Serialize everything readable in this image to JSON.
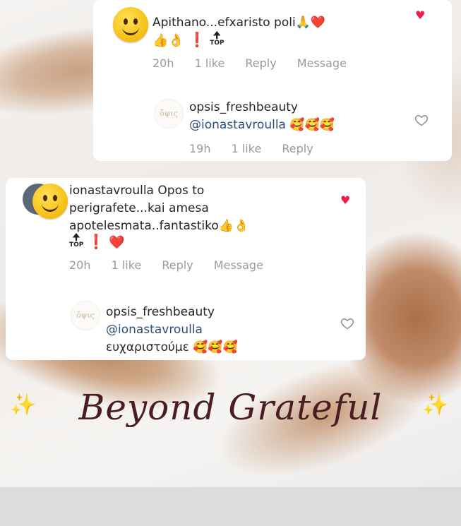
{
  "card1": {
    "comment": {
      "text": "Apithano...efxaristo poli",
      "emojis_line1": "🙏❤️",
      "emojis_line2": "👍👌",
      "top_label": "TOP",
      "meta": {
        "time": "20h",
        "likes": "1 like",
        "reply": "Reply",
        "message": "Message"
      }
    },
    "reply": {
      "username": "opsis_freshbeauty",
      "mention": "@ionastavroulla",
      "emojis": "🥰🥰🥰",
      "meta": {
        "time": "19h",
        "likes": "1 like",
        "reply": "Reply"
      }
    }
  },
  "card2": {
    "comment": {
      "username": "ionastavroulla",
      "text_line1": "Opos to",
      "text_line2": "perigrafete...kai amesa",
      "text_line3": "apotelesmata..fantastiko",
      "emojis_line3": "👍👌",
      "top_label": "TOP",
      "meta": {
        "time": "20h",
        "likes": "1 like",
        "reply": "Reply",
        "message": "Message"
      }
    },
    "reply": {
      "username": "opsis_freshbeauty",
      "mention": "@ionastavroulla",
      "text": "ευχαριστούμε",
      "emojis": "🥰🥰🥰"
    }
  },
  "brand_avatar_text": "ὄψις",
  "overlay": {
    "caption": "Beyond Grateful",
    "sparkle": "✨"
  },
  "colors": {
    "liked_heart": "#ee1a4a",
    "mention": "#2b4f7d",
    "caption": "#4a1d22"
  }
}
